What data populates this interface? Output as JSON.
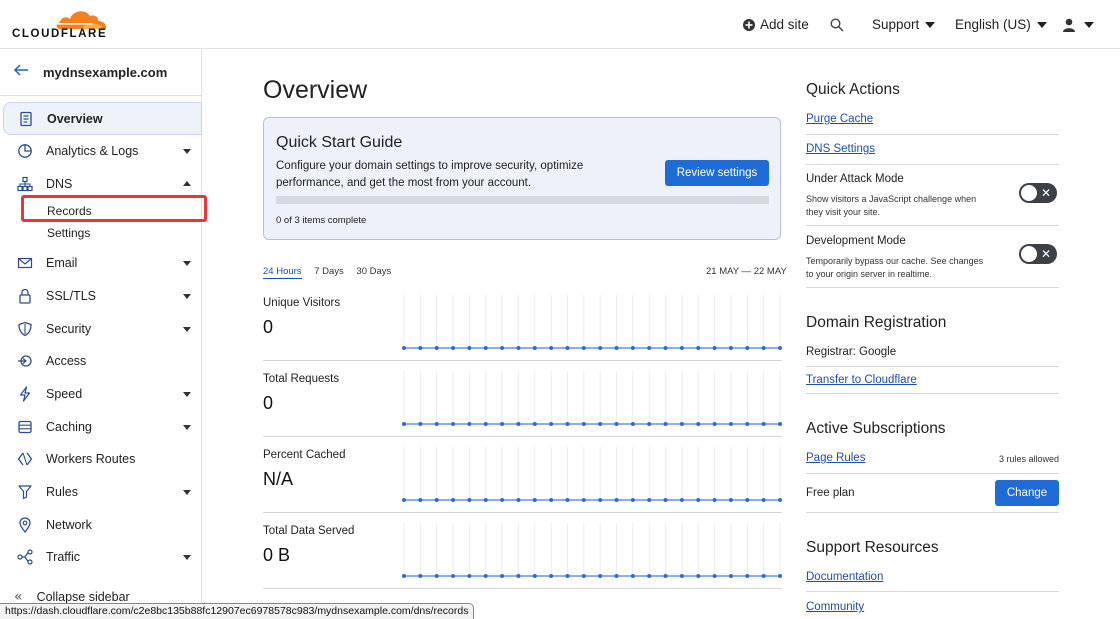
{
  "header": {
    "brand": "CLOUDFLARE",
    "add_site": "Add site",
    "support": "Support",
    "language": "English (US)",
    "brand_color": "#f48120"
  },
  "sidebar": {
    "zone": "mydnsexample.com",
    "items": [
      {
        "label": "Overview",
        "icon": "document-icon"
      },
      {
        "label": "Analytics & Logs",
        "icon": "chart-pie-icon"
      },
      {
        "label": "DNS",
        "icon": "network-tree-icon"
      },
      {
        "label": "Email",
        "icon": "mail-icon"
      },
      {
        "label": "SSL/TLS",
        "icon": "lock-icon"
      },
      {
        "label": "Security",
        "icon": "shield-icon"
      },
      {
        "label": "Access",
        "icon": "access-icon"
      },
      {
        "label": "Speed",
        "icon": "bolt-icon"
      },
      {
        "label": "Caching",
        "icon": "storage-icon"
      },
      {
        "label": "Workers Routes",
        "icon": "workers-icon"
      },
      {
        "label": "Rules",
        "icon": "rules-icon"
      },
      {
        "label": "Network",
        "icon": "location-pin-icon"
      },
      {
        "label": "Traffic",
        "icon": "traffic-icon"
      }
    ],
    "dns_sub": {
      "records": "Records",
      "settings": "Settings"
    },
    "collapse": "Collapse sidebar"
  },
  "status_url": "https://dash.cloudflare.com/c2e8bc135b88fc12907ec6978578c983/mydnsexample.com/dns/records",
  "main": {
    "title": "Overview",
    "quick_start": {
      "title": "Quick Start Guide",
      "description": "Configure your domain settings to improve security, optimize performance, and get the most from your account.",
      "button": "Review settings",
      "progress_text": "0 of 3 items complete",
      "progress_fraction": 0
    },
    "ranges": [
      "24 Hours",
      "7 Days",
      "30 Days"
    ],
    "selected_range": "24 Hours",
    "date_range": "21 MAY — 22 MAY",
    "metrics": [
      {
        "label": "Unique Visitors",
        "value": "0"
      },
      {
        "label": "Total Requests",
        "value": "0"
      },
      {
        "label": "Percent Cached",
        "value": "N/A"
      },
      {
        "label": "Total Data Served",
        "value": "0 B"
      }
    ],
    "accent": "#1f6cd6"
  },
  "right": {
    "quick_actions": {
      "heading": "Quick Actions",
      "purge": "Purge Cache",
      "dns_settings": "DNS Settings",
      "under_attack": {
        "title": "Under Attack Mode",
        "desc": "Show visitors a JavaScript challenge when they visit your site.",
        "on": false
      },
      "dev_mode": {
        "title": "Development Mode",
        "desc": "Temporarily bypass our cache. See changes to your origin server in realtime.",
        "on": false
      }
    },
    "domain_registration": {
      "heading": "Domain Registration",
      "registrar": "Registrar: Google",
      "transfer": "Transfer to Cloudflare"
    },
    "subscriptions": {
      "heading": "Active Subscriptions",
      "page_rules": "Page Rules",
      "rules_allowed": "3 rules allowed",
      "plan": "Free plan",
      "change": "Change"
    },
    "support": {
      "heading": "Support Resources",
      "documentation": "Documentation",
      "community": "Community"
    }
  }
}
